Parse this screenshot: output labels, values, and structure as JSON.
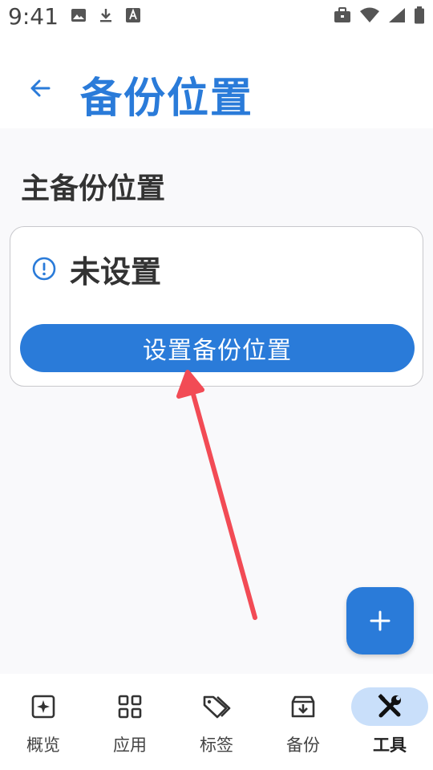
{
  "status_bar": {
    "time": "9:41"
  },
  "app_bar": {
    "title": "备份位置"
  },
  "main": {
    "section_title": "主备份位置",
    "card": {
      "status": "未设置",
      "button_label": "设置备份位置"
    }
  },
  "bottom_nav": {
    "items": [
      {
        "label": "概览",
        "icon": "overview-icon"
      },
      {
        "label": "应用",
        "icon": "apps-grid-icon"
      },
      {
        "label": "标签",
        "icon": "tags-icon"
      },
      {
        "label": "备份",
        "icon": "backup-archive-icon"
      },
      {
        "label": "工具",
        "icon": "tools-icon",
        "active": true
      }
    ]
  },
  "colors": {
    "accent": "#2a7bd9",
    "active_pill": "#c9dffa",
    "annotation_arrow": "#f24b55"
  }
}
